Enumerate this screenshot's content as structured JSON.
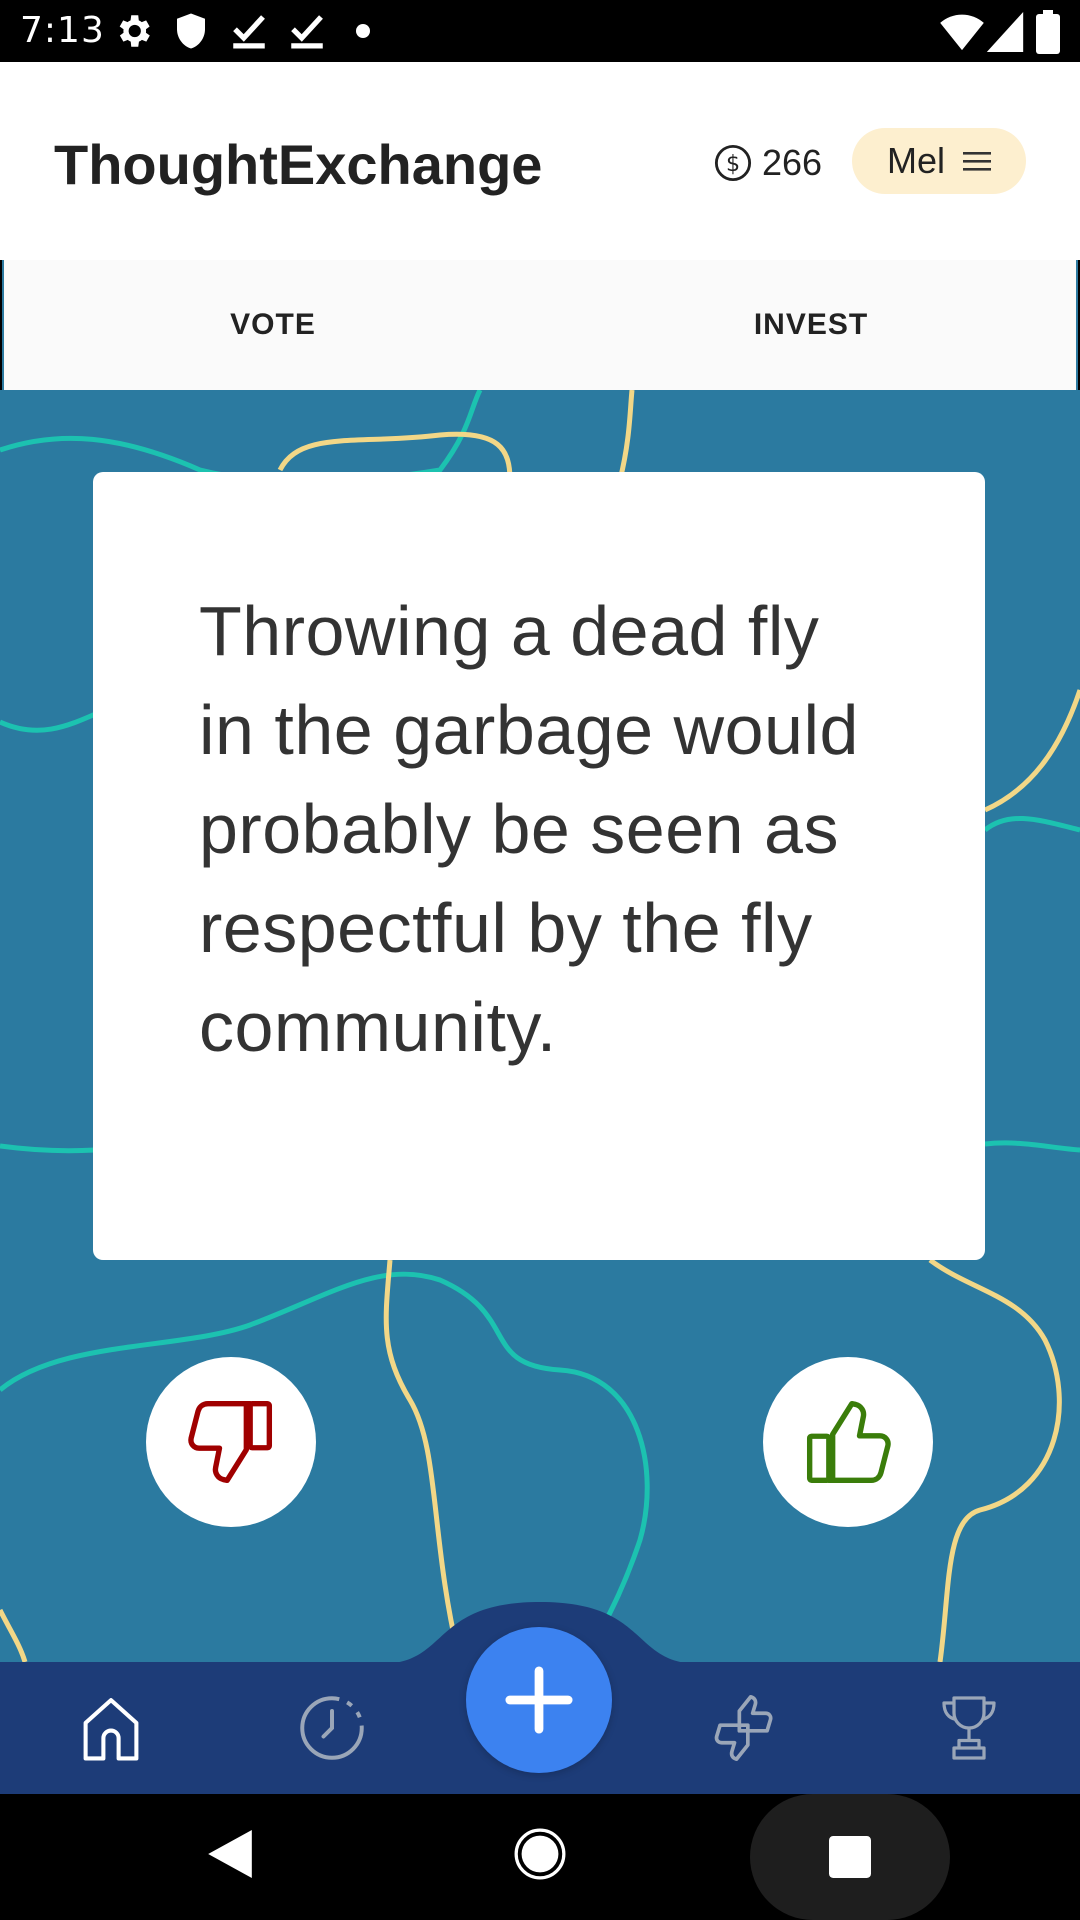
{
  "status_bar": {
    "time": "7:13",
    "left_icons": [
      "gear-icon",
      "shield-icon",
      "check-download-icon",
      "check-download-icon",
      "dot-icon"
    ],
    "right_icons": [
      "wifi-icon",
      "signal-icon",
      "battery-icon"
    ]
  },
  "header": {
    "title": "ThoughtExchange",
    "coin_count": "266",
    "coin_icon": "dollar-coin-icon",
    "user_name": "Mel",
    "menu_icon": "hamburger-menu-icon",
    "pill_color": "#fdefcf"
  },
  "tabs": [
    {
      "label": "VOTE",
      "active": true
    },
    {
      "label": "INVEST",
      "active": false
    }
  ],
  "thought": {
    "text": "Throwing a dead fly in the garbage would probably be seen as respectful by the fly community."
  },
  "vote_buttons": {
    "dislike_icon": "thumbs-down-icon",
    "like_icon": "thumbs-up-icon",
    "dislike_color": "#a00000",
    "like_color": "#3a7d0a"
  },
  "bottom_nav": {
    "items": [
      "home-icon",
      "history-clock-icon",
      "add-icon",
      "thumbs-icon",
      "trophy-icon"
    ],
    "background": "#1d3c78",
    "add_color": "#3c82f0"
  },
  "colors": {
    "main_background": "#2b7aa0",
    "line_teal": "#1cc2b0",
    "line_yellow": "#f2d787"
  }
}
